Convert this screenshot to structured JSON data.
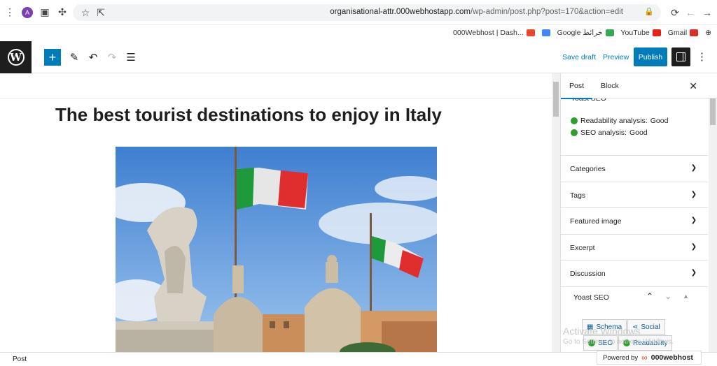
{
  "browser": {
    "profile_initial": "A",
    "url_host": "organisational-attr.000webhostapp.com",
    "url_path": "/wp-admin/post.php?post=170&action=edit",
    "bookmarks": [
      {
        "label": "000Webhost | Dash...",
        "icon": "webhost-icon",
        "color": "#e8492e"
      },
      {
        "label": "Google خرائط",
        "icon": "maps-icon",
        "color": "#4285f4"
      },
      {
        "label": "YouTube",
        "icon": "youtube-icon",
        "color": "#e62117"
      },
      {
        "label": "Gmail",
        "icon": "gmail-icon",
        "color": "#d93025"
      }
    ]
  },
  "toolbar": {
    "save_draft": "Save draft",
    "preview": "Preview",
    "publish": "Publish",
    "accent": "#007cba"
  },
  "editor": {
    "title": "The best tourist destinations to enjoy in Italy"
  },
  "sidebar": {
    "tabs": [
      "Post",
      "Block"
    ],
    "yoast_header": "Yoast SEO",
    "analysis": [
      {
        "label": "Readability analysis:",
        "value": "Good"
      },
      {
        "label": "SEO analysis:",
        "value": "Good"
      }
    ],
    "panels": [
      "Categories",
      "Tags",
      "Featured image",
      "Excerpt",
      "Discussion"
    ],
    "yoast_panel_title": "Yoast SEO",
    "yoast_buttons": {
      "schema": "Schema",
      "social": "Social",
      "seo": "SEO",
      "readability": "Readability"
    }
  },
  "watermark": {
    "line1": "Activate Windows",
    "line2": "Go to Settings to activate Windows."
  },
  "status": {
    "label": "Post"
  },
  "powered": {
    "prefix": "Powered by",
    "brand": "000webhost"
  }
}
